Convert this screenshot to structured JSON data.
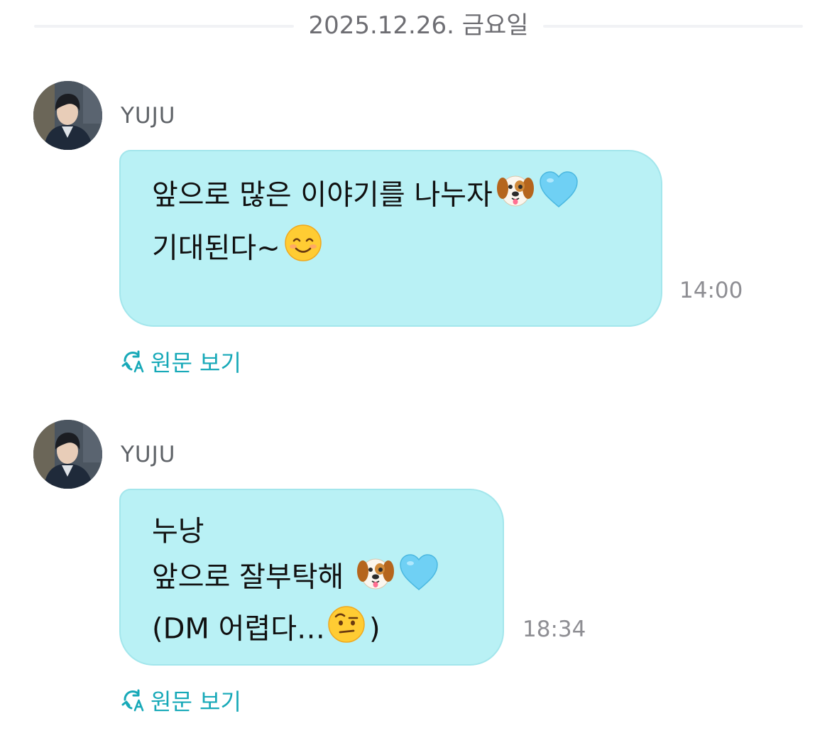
{
  "date_divider": {
    "label": "2025.12.26. 금요일"
  },
  "messages": [
    {
      "sender": "YUJU",
      "lines": [
        "앞으로 많은 이야기를 나누자",
        "기대된다~"
      ],
      "emojis": [
        "dog-face-icon",
        "light-blue-heart-icon",
        "smiling-face-icon"
      ],
      "time": "14:00",
      "translate_label": "원문 보기"
    },
    {
      "sender": "YUJU",
      "lines": [
        "누낭",
        "앞으로 잘부탁해 ",
        "(DM 어렵다…",
        ")"
      ],
      "emojis": [
        "dog-face-icon",
        "light-blue-heart-icon",
        "face-with-raised-eyebrow-icon"
      ],
      "time": "18:34",
      "translate_label": "원문 보기"
    }
  ],
  "colors": {
    "bubble": "#b9f1f5",
    "bubble_border": "#a3e6ec",
    "link": "#17a9b8",
    "time": "#8e8e93",
    "divider_line": "#f1f2f5"
  }
}
